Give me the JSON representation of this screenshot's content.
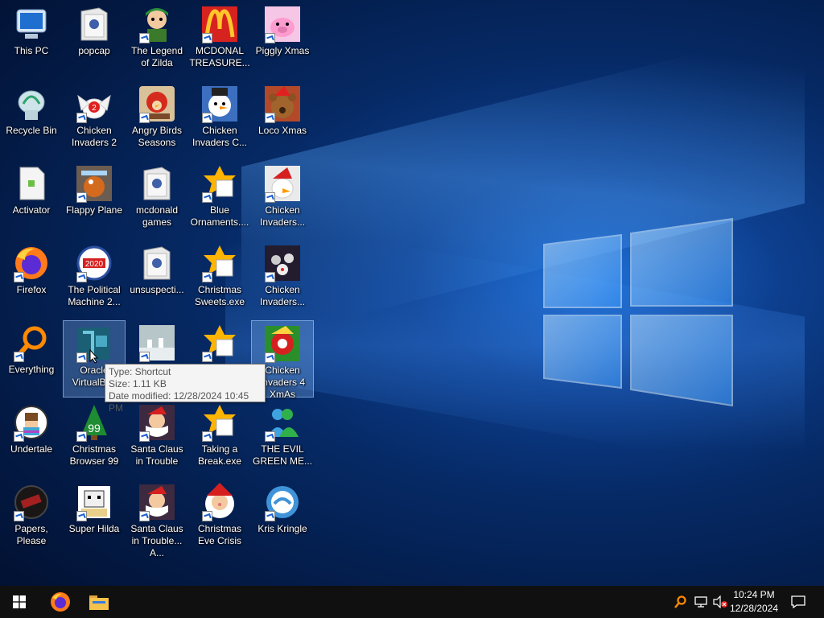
{
  "desktop": {
    "icons": [
      {
        "label": "This PC",
        "icon": "monitor-icon"
      },
      {
        "label": "popcap",
        "icon": "folder-icon"
      },
      {
        "label": "The Legend of Zilda",
        "icon": "zilda-game-icon"
      },
      {
        "label": "MCDONAL TREASURE...",
        "icon": "mcdonalds-icon"
      },
      {
        "label": "Piggly Xmas",
        "icon": "pig-icon"
      },
      {
        "label": "Recycle Bin",
        "icon": "recycle-bin-icon"
      },
      {
        "label": "Chicken Invaders 2",
        "icon": "chicken-invaders-2-icon"
      },
      {
        "label": "Angry Birds Seasons",
        "icon": "angry-birds-icon"
      },
      {
        "label": "Chicken Invaders C...",
        "icon": "chicken-snowman-icon"
      },
      {
        "label": "Loco Xmas",
        "icon": "teddy-bear-icon"
      },
      {
        "label": "Activator",
        "icon": "file-icon"
      },
      {
        "label": "Flappy Plane",
        "icon": "flappy-plane-icon"
      },
      {
        "label": "mcdonald games",
        "icon": "folder-icon"
      },
      {
        "label": "Blue Ornaments....",
        "icon": "game-exe-icon"
      },
      {
        "label": "Chicken Invaders...",
        "icon": "chicken-santa-icon"
      },
      {
        "label": "Firefox",
        "icon": "firefox-icon"
      },
      {
        "label": "The Political Machine 2...",
        "icon": "political-machine-icon"
      },
      {
        "label": "unsuspecti...",
        "icon": "folder-icon"
      },
      {
        "label": "Christmas Sweets.exe",
        "icon": "game-exe-icon"
      },
      {
        "label": "Chicken Invaders...",
        "icon": "chicken-space-icon"
      },
      {
        "label": "Everything",
        "icon": "magnifier-icon"
      },
      {
        "label": "Oracle VirtualBox",
        "icon": "virtualbox-icon"
      },
      {
        "label": "",
        "icon": "snow-game-icon"
      },
      {
        "label": "",
        "icon": "game-exe-icon"
      },
      {
        "label": "Chicken Invaders 4 XmAs",
        "icon": "chicken-xmas-icon"
      },
      {
        "label": "Undertale",
        "icon": "undertale-icon"
      },
      {
        "label": "Christmas Browser 99",
        "icon": "christmas-tree-icon"
      },
      {
        "label": "Santa Claus in Trouble",
        "icon": "santa-icon"
      },
      {
        "label": "Taking a Break.exe",
        "icon": "game-exe-icon"
      },
      {
        "label": "THE EVIL GREEN ME...",
        "icon": "messenger-icon"
      },
      {
        "label": "Papers, Please",
        "icon": "papers-please-icon"
      },
      {
        "label": "Super Hilda",
        "icon": "super-hilda-icon"
      },
      {
        "label": "Santa Claus in Trouble... A...",
        "icon": "santa-icon"
      },
      {
        "label": "Christmas Eve Crisis",
        "icon": "santa-face-icon"
      },
      {
        "label": "Kris Kringle",
        "icon": "kris-kringle-icon"
      }
    ]
  },
  "tooltip": {
    "type": "Type: Shortcut",
    "size": "Size: 1.11 KB",
    "modified": "Date modified: 12/28/2024 10:45 PM"
  },
  "taskbar": {
    "time": "10:24 PM",
    "date": "12/28/2024"
  },
  "colors": {
    "accent": "#1a73e8",
    "taskbar": "#101010"
  }
}
